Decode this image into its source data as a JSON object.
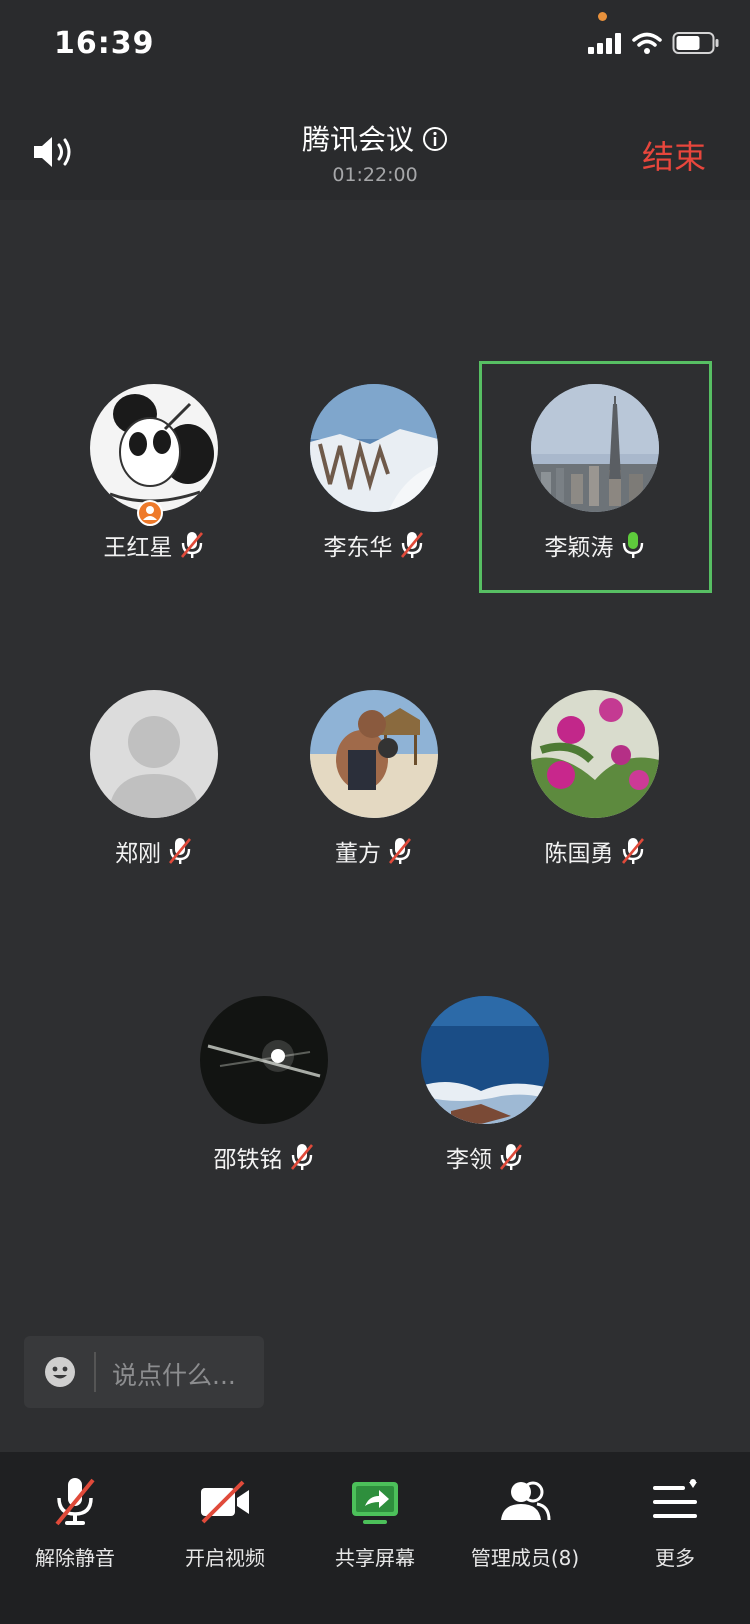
{
  "status_bar": {
    "time": "16:39"
  },
  "header": {
    "title": "腾讯会议",
    "timer": "01:22:00",
    "end_label": "结束"
  },
  "members": [
    {
      "name": "王红星",
      "muted": true,
      "host": true
    },
    {
      "name": "李东华",
      "muted": true
    },
    {
      "name": "李颖涛",
      "muted": false,
      "speaking": true
    },
    {
      "name": "郑刚",
      "muted": true
    },
    {
      "name": "董方",
      "muted": true
    },
    {
      "name": "陈国勇",
      "muted": true
    },
    {
      "name": "邵铁铭",
      "muted": true
    },
    {
      "name": "李领",
      "muted": true
    }
  ],
  "chat": {
    "placeholder": "说点什么..."
  },
  "toolbar": {
    "unmute_label": "解除静音",
    "video_label": "开启视频",
    "share_label": "共享屏幕",
    "members_label": "管理成员(8)",
    "more_label": "更多"
  },
  "colors": {
    "end": "#e8463c",
    "active": "#57bf63",
    "share": "#4cc05a",
    "host_badge": "#ee7a2b",
    "mic_off": "#e04a3a"
  }
}
